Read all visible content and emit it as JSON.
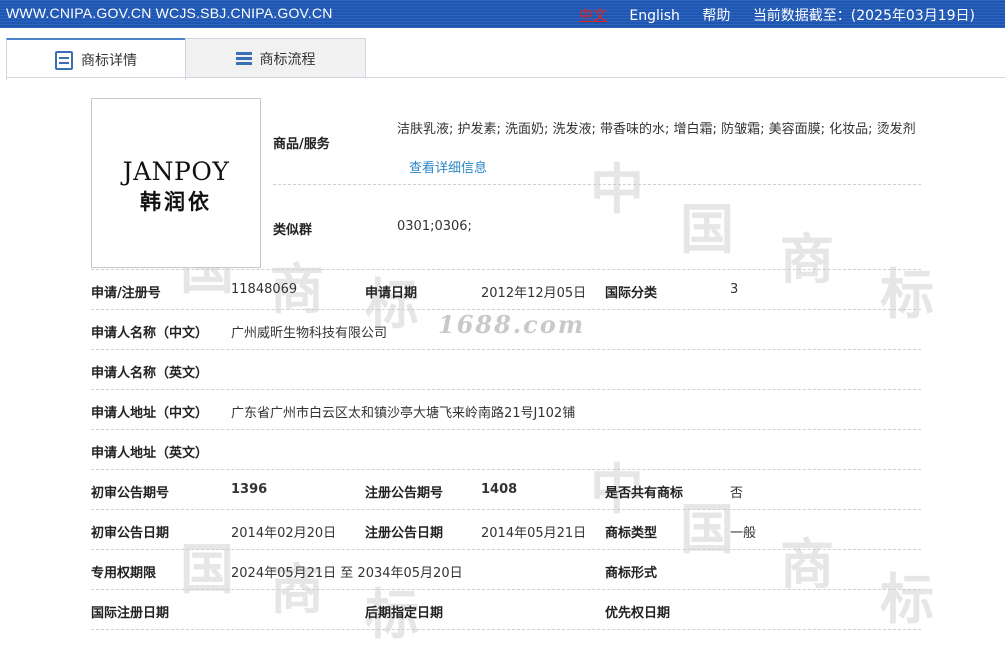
{
  "topbar": {
    "sites": "WWW.CNIPA.GOV.CN WCJS.SBJ.CNIPA.GOV.CN",
    "lang_zh": "中文",
    "lang_en": "English",
    "help": "帮助",
    "data_date": "当前数据截至：(2025年03月19日)"
  },
  "tabs": [
    {
      "label": "商标详情",
      "icon": "document-icon"
    },
    {
      "label": "商标流程",
      "icon": "list-icon"
    }
  ],
  "watermark": {
    "site": "1688.com",
    "chars": [
      "中",
      "国",
      "商",
      "标"
    ]
  },
  "logo": {
    "en": "JANPOY",
    "cn": "韩润依"
  },
  "goods": {
    "label": "商品/服务",
    "text": "洁肤乳液; 护发素; 洗面奶; 洗发液; 带香味的水; 增白霜; 防皱霜; 美容面膜; 化妆品; 烫发剂",
    "link": "查看详细信息"
  },
  "similar": {
    "label": "类似群",
    "value": "0301;0306;"
  },
  "rows": {
    "reg_no_label": "申请/注册号",
    "reg_no": "11848069",
    "apply_date_label": "申请日期",
    "apply_date": "2012年12月05日",
    "intl_class_label": "国际分类",
    "intl_class": "3",
    "applicant_cn_label": "申请人名称（中文）",
    "applicant_cn": "广州威昕生物科技有限公司",
    "applicant_en_label": "申请人名称（英文）",
    "applicant_en": "",
    "address_cn_label": "申请人地址（中文）",
    "address_cn": "广东省广州市白云区太和镇沙亭大塘飞来岭南路21号J102铺",
    "address_en_label": "申请人地址（英文）",
    "address_en": "",
    "prelim_no_label": "初审公告期号",
    "prelim_no": "1396",
    "reg_pub_no_label": "注册公告期号",
    "reg_pub_no": "1408",
    "shared_label": "是否共有商标",
    "shared": "否",
    "prelim_date_label": "初审公告日期",
    "prelim_date": "2014年02月20日",
    "reg_pub_date_label": "注册公告日期",
    "reg_pub_date": "2014年05月21日",
    "tm_type_label": "商标类型",
    "tm_type": "一般",
    "exclusive_label": "专用权期限",
    "exclusive": "2024年05月21日 至 2034年05月20日",
    "tm_form_label": "商标形式",
    "tm_form": "",
    "intl_reg_date_label": "国际注册日期",
    "intl_reg_date": "",
    "later_date_label": "后期指定日期",
    "later_date": "",
    "priority_date_label": "优先权日期",
    "priority_date": ""
  }
}
